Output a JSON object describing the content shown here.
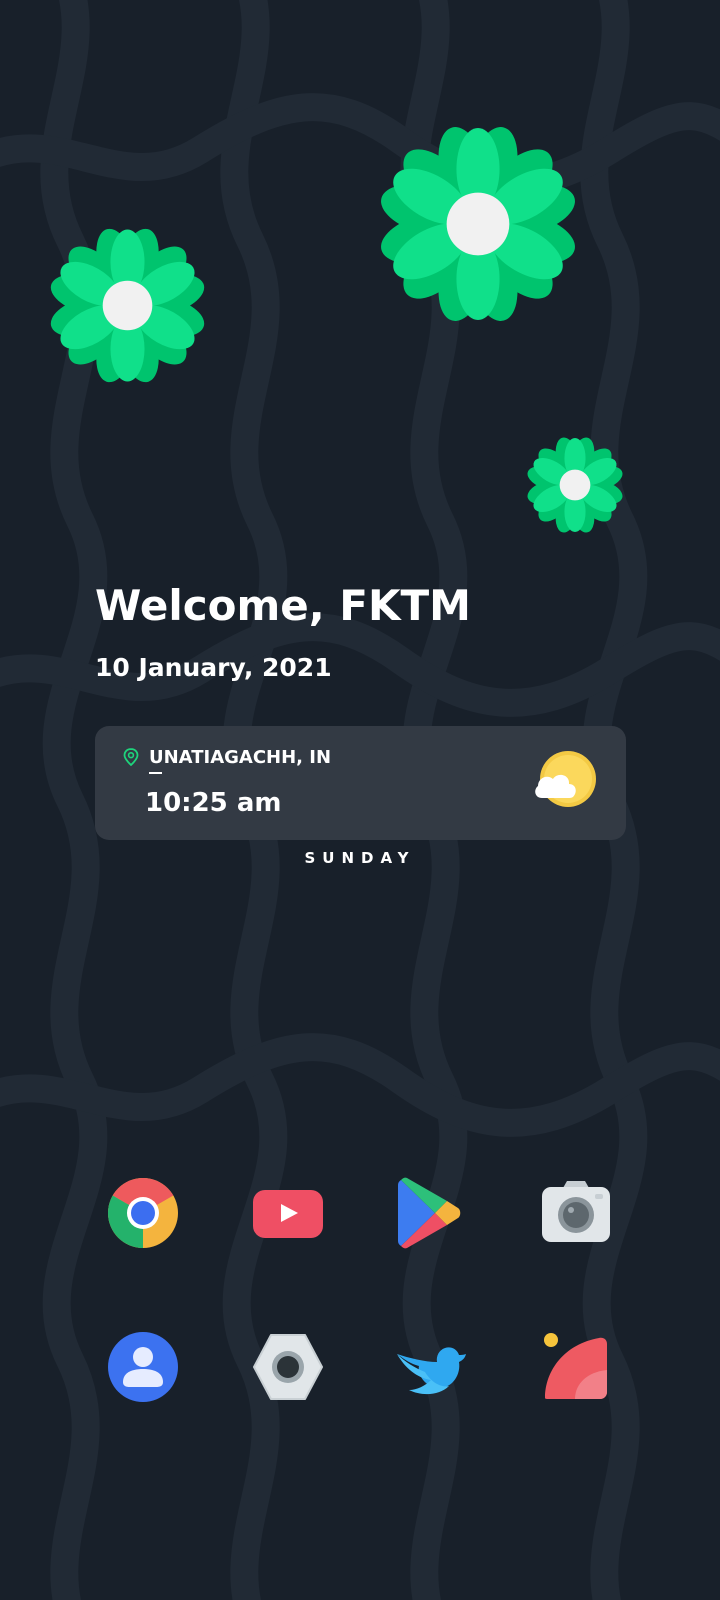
{
  "greeting": "Welcome, FKTM",
  "date": "10 January, 2021",
  "weather_widget": {
    "location": "UNATIAGACHH, IN",
    "time": "10:25 am",
    "condition_icon": "partly-cloudy-icon",
    "location_icon": "location-pin-icon"
  },
  "day": "SUNDAY",
  "apps": [
    {
      "name": "chrome",
      "icon": "chrome-icon"
    },
    {
      "name": "youtube",
      "icon": "youtube-icon"
    },
    {
      "name": "play-store",
      "icon": "play-store-icon"
    },
    {
      "name": "camera",
      "icon": "camera-icon"
    },
    {
      "name": "contacts",
      "icon": "contacts-icon"
    },
    {
      "name": "settings",
      "icon": "settings-icon"
    },
    {
      "name": "twitter",
      "icon": "twitter-icon"
    },
    {
      "name": "gallery",
      "icon": "gallery-icon"
    }
  ],
  "colors": {
    "background": "#18202a",
    "card": "#333a44",
    "flower": "#00d47a",
    "accent_green": "#1ed47c"
  }
}
